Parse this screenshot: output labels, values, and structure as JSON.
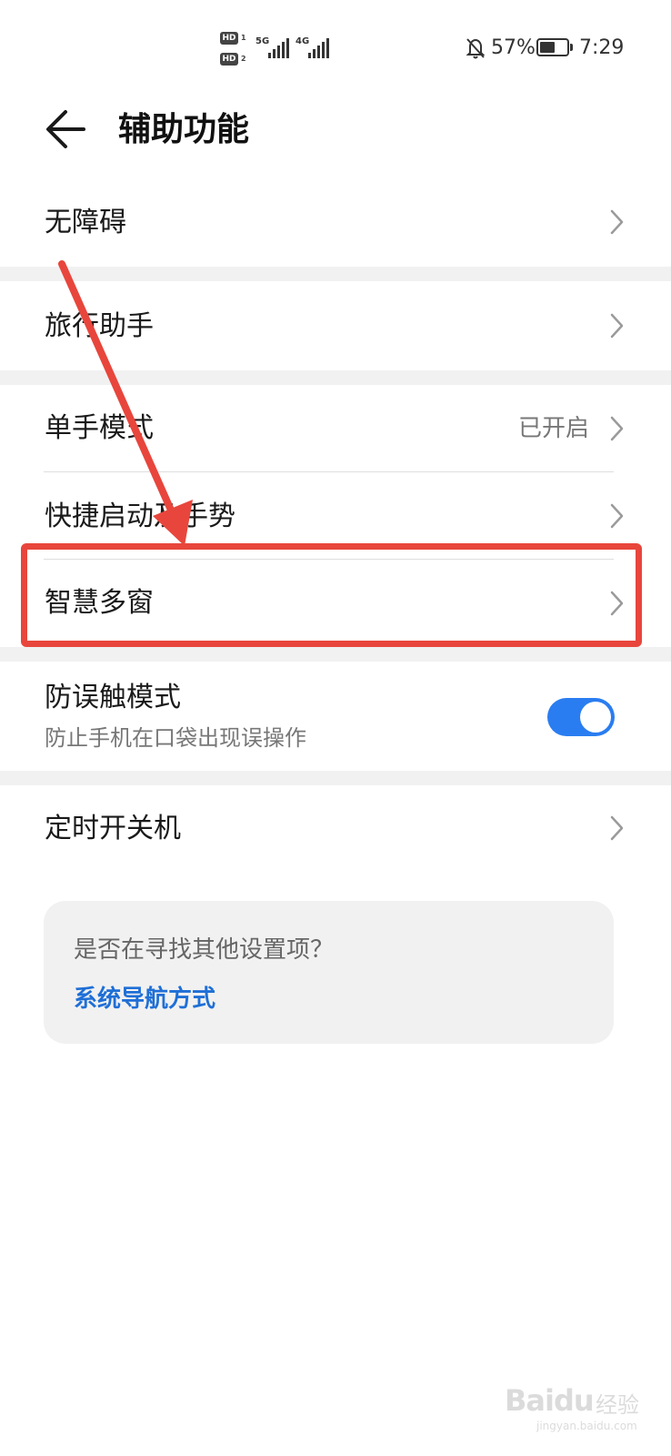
{
  "status_bar": {
    "hd1": "HD",
    "hd1_num": "1",
    "hd2": "HD",
    "hd2_num": "2",
    "net1": "5G",
    "net2": "4G",
    "battery_percent": "57%",
    "battery_level": 0.57,
    "time": "7:29",
    "icons": [
      "bell-off-icon",
      "battery-icon",
      "signal-icon"
    ]
  },
  "header": {
    "title": "辅助功能",
    "back_icon": "arrow-left-icon"
  },
  "settings": {
    "accessibility": {
      "label": "无障碍"
    },
    "travel_assistant": {
      "label": "旅行助手"
    },
    "one_hand_mode": {
      "label": "单手模式",
      "value": "已开启"
    },
    "shortcuts_gestures": {
      "label": "快捷启动及手势"
    },
    "smart_multiwindow": {
      "label": "智慧多窗"
    },
    "pocket_mode": {
      "label": "防误触模式",
      "description": "防止手机在口袋出现误操作",
      "enabled": true
    },
    "scheduled_power": {
      "label": "定时开关机"
    }
  },
  "suggestion_card": {
    "question": "是否在寻找其他设置项？",
    "link": "系统导航方式"
  },
  "annotation": {
    "color": "#e8463c"
  },
  "watermark": {
    "brand": "Baidu",
    "sub": "经验",
    "site": "jingyan.baidu.com"
  },
  "colors": {
    "accent": "#2a7df0",
    "link": "#1f6fd6",
    "section_gap": "#f1f1f1"
  }
}
